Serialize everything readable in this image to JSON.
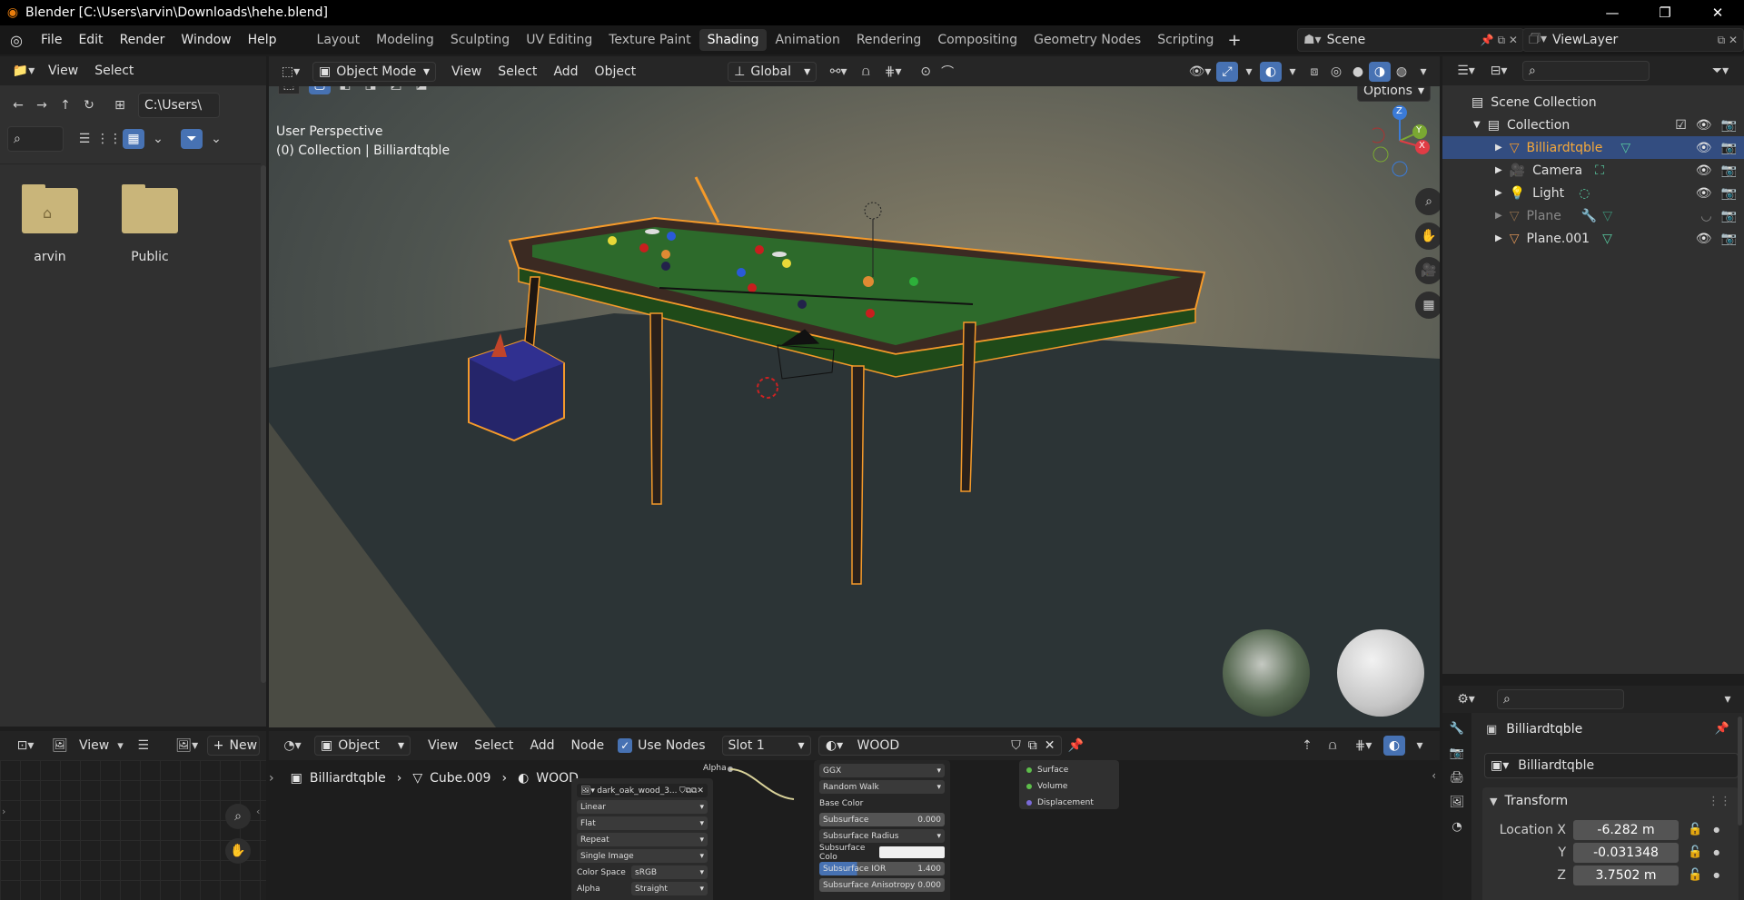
{
  "window": {
    "title": "Blender [C:\\Users\\arvin\\Downloads\\hehe.blend]",
    "controls": [
      "—",
      "❐",
      "✕"
    ]
  },
  "menu": [
    "File",
    "Edit",
    "Render",
    "Window",
    "Help"
  ],
  "workspaces": [
    "Layout",
    "Modeling",
    "Sculpting",
    "UV Editing",
    "Texture Paint",
    "Shading",
    "Animation",
    "Rendering",
    "Compositing",
    "Geometry Nodes",
    "Scripting"
  ],
  "active_workspace": "Shading",
  "scene": "Scene",
  "view_layer": "ViewLayer",
  "file_browser": {
    "menu": [
      "View",
      "Select"
    ],
    "path": "C:\\Users\\",
    "folders": [
      "arvin",
      "Public"
    ]
  },
  "viewport": {
    "mode": "Object Mode",
    "menus": [
      "View",
      "Select",
      "Add",
      "Object"
    ],
    "orientation": "Global",
    "options": "Options",
    "view_name": "User Perspective",
    "collection_info": "(0) Collection | Billiardtqble",
    "gizmo": {
      "z": "Z",
      "y": "Y",
      "x": "X"
    }
  },
  "outliner": {
    "root": "Scene Collection",
    "collection": "Collection",
    "items": [
      {
        "name": "Billiardtqble",
        "selected": true
      },
      {
        "name": "Camera",
        "selected": false
      },
      {
        "name": "Light",
        "selected": false
      },
      {
        "name": "Plane",
        "selected": false
      },
      {
        "name": "Plane.001",
        "selected": false
      }
    ]
  },
  "properties": {
    "object_name": "Billiardtqble",
    "object_field": "Billiardtqble",
    "section": "Transform",
    "location": [
      {
        "label": "Location X",
        "value": "-6.282 m"
      },
      {
        "label": "Y",
        "value": "-0.031348"
      },
      {
        "label": "Z",
        "value": "3.7502 m"
      }
    ]
  },
  "image_editor": {
    "view": "View",
    "new_label": "New"
  },
  "node_editor": {
    "object": "Object",
    "menus": [
      "View",
      "Select",
      "Add",
      "Node"
    ],
    "use_nodes": "Use Nodes",
    "slot": "Slot 1",
    "material": "WOOD",
    "breadcrumb": [
      "Billiardtqble",
      "Cube.009",
      "WOOD"
    ],
    "image_node": {
      "image": "dark_oak_wood_3...",
      "fields": [
        "Linear",
        "Flat",
        "Repeat",
        "Single Image"
      ],
      "color_space_label": "Color Space",
      "color_space": "sRGB",
      "alpha_label": "Alpha",
      "alpha": "Straight",
      "alpha_out": "Alpha"
    },
    "bsdf_node": {
      "dist": "GGX",
      "sss": "Random Walk",
      "base_color": "Base Color",
      "rows": [
        {
          "label": "Subsurface",
          "value": "0.000"
        },
        {
          "label": "Subsurface Radius",
          "value": ""
        },
        {
          "label": "Subsurface Colo",
          "value": ""
        },
        {
          "label": "Subsurface IOR",
          "value": "1.400"
        },
        {
          "label": "Subsurface Anisotropy",
          "value": "0.000"
        }
      ]
    },
    "output_node": [
      "Surface",
      "Volume",
      "Displacement"
    ]
  },
  "colors": {
    "accent": "#4772b3",
    "selection": "#e87d0d",
    "bg": "#303030"
  }
}
